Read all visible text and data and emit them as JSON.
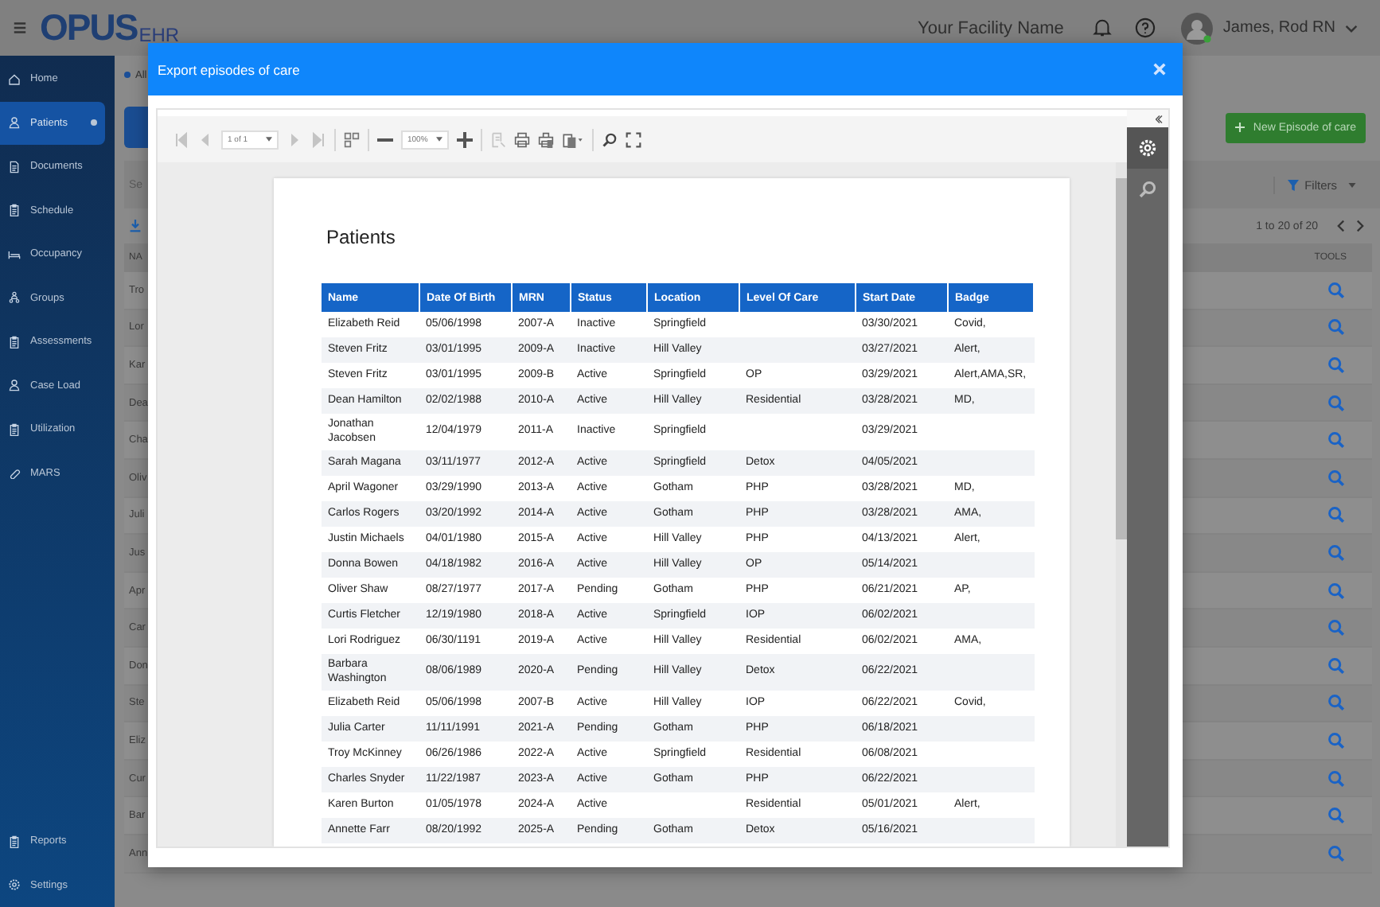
{
  "app": {
    "logo": "OPUS",
    "logo_suffix": "EHR",
    "facility": "Your Facility Name",
    "user": "James, Rod RN"
  },
  "sidebar": {
    "items": [
      {
        "label": "Home",
        "selected": false
      },
      {
        "label": "Patients",
        "selected": true
      },
      {
        "label": "Documents",
        "selected": false
      },
      {
        "label": "Schedule",
        "selected": false
      },
      {
        "label": "Occupancy",
        "selected": false
      },
      {
        "label": "Groups",
        "selected": false
      },
      {
        "label": "Assessments",
        "selected": false
      },
      {
        "label": "Case Load",
        "selected": false
      },
      {
        "label": "Utilization",
        "selected": false
      },
      {
        "label": "MARS",
        "selected": false
      }
    ],
    "footer_items": [
      {
        "label": "Reports",
        "selected": false
      },
      {
        "label": "Settings",
        "selected": false
      }
    ]
  },
  "background": {
    "breadcrumb": "All",
    "new_button": "New Episode of care",
    "search_placeholder": "Se",
    "filters": "Filters",
    "pagination": "1 to 20 of 20",
    "name_header": "NA",
    "tools_header": "TOOLS",
    "rows": [
      "Tro",
      "Lor",
      "Kar",
      "Dea",
      "Cha",
      "Oliv",
      "Juli",
      "Jus",
      "Apr",
      "Car",
      "Don",
      "Ste",
      "Eliz",
      "Cur",
      "Bar",
      "Ann"
    ]
  },
  "dialog": {
    "title": "Export episodes of care",
    "page_select": "1 of 1",
    "zoom_select": "100%",
    "report": {
      "title": "Patients",
      "columns": [
        "Name",
        "Date Of Birth",
        "MRN",
        "Status",
        "Location",
        "Level Of Care",
        "Start Date",
        "Badge"
      ],
      "rows": [
        [
          "Elizabeth Reid",
          "05/06/1998",
          "2007-A",
          "Inactive",
          "Springfield",
          null,
          "03/30/2021",
          "Covid,"
        ],
        [
          "Steven Fritz",
          "03/01/1995",
          "2009-A",
          "Inactive",
          "Hill Valley",
          null,
          "03/27/2021",
          "Alert,"
        ],
        [
          "Steven Fritz",
          "03/01/1995",
          "2009-B",
          "Active",
          "Springfield",
          "OP",
          "03/29/2021",
          "Alert,AMA,SR,"
        ],
        [
          "Dean Hamilton",
          "02/02/1988",
          "2010-A",
          "Active",
          "Hill Valley",
          "Residential",
          "03/28/2021",
          "MD,"
        ],
        [
          "Jonathan Jacobsen",
          "12/04/1979",
          "2011-A",
          "Inactive",
          "Springfield",
          null,
          "03/29/2021",
          null
        ],
        [
          "Sarah Magana",
          "03/11/1977",
          "2012-A",
          "Active",
          "Springfield",
          "Detox",
          "04/05/2021",
          null
        ],
        [
          "April Wagoner",
          "03/29/1990",
          "2013-A",
          "Active",
          "Gotham",
          "PHP",
          "03/28/2021",
          "MD,"
        ],
        [
          "Carlos Rogers",
          "03/20/1992",
          "2014-A",
          "Active",
          "Gotham",
          "PHP",
          "03/28/2021",
          "AMA,"
        ],
        [
          "Justin Michaels",
          "04/01/1980",
          "2015-A",
          "Active",
          "Hill Valley",
          "PHP",
          "04/13/2021",
          "Alert,"
        ],
        [
          "Donna Bowen",
          "04/18/1982",
          "2016-A",
          "Active",
          "Hill Valley",
          "OP",
          "05/14/2021",
          null
        ],
        [
          "Oliver Shaw",
          "08/27/1977",
          "2017-A",
          "Pending",
          "Gotham",
          "PHP",
          "06/21/2021",
          "AP,"
        ],
        [
          "Curtis Fletcher",
          "12/19/1980",
          "2018-A",
          "Active",
          "Springfield",
          "IOP",
          "06/02/2021",
          null
        ],
        [
          "Lori Rodriguez",
          "06/30/1191",
          "2019-A",
          "Active",
          "Hill Valley",
          "Residential",
          "06/02/2021",
          "AMA,"
        ],
        [
          "Barbara Washington",
          "08/06/1989",
          "2020-A",
          "Pending",
          "Hill Valley",
          "Detox",
          "06/22/2021",
          null
        ],
        [
          "Elizabeth Reid",
          "05/06/1998",
          "2007-B",
          "Active",
          "Hill Valley",
          "IOP",
          "06/22/2021",
          "Covid,"
        ],
        [
          "Julia Carter",
          "11/11/1991",
          "2021-A",
          "Pending",
          "Gotham",
          "PHP",
          "06/18/2021",
          null
        ],
        [
          "Troy McKinney",
          "06/26/1986",
          "2022-A",
          "Active",
          "Springfield",
          "Residential",
          "06/08/2021",
          null
        ],
        [
          "Charles Snyder",
          "11/22/1987",
          "2023-A",
          "Active",
          "Gotham",
          "PHP",
          "06/22/2021",
          null
        ],
        [
          "Karen Burton",
          "01/05/1978",
          "2024-A",
          "Active",
          null,
          "Residential",
          "05/01/2021",
          "Alert,"
        ],
        [
          "Annette Farr",
          "08/20/1992",
          "2025-A",
          "Pending",
          "Gotham",
          "Detox",
          "05/16/2021",
          null
        ]
      ]
    }
  }
}
